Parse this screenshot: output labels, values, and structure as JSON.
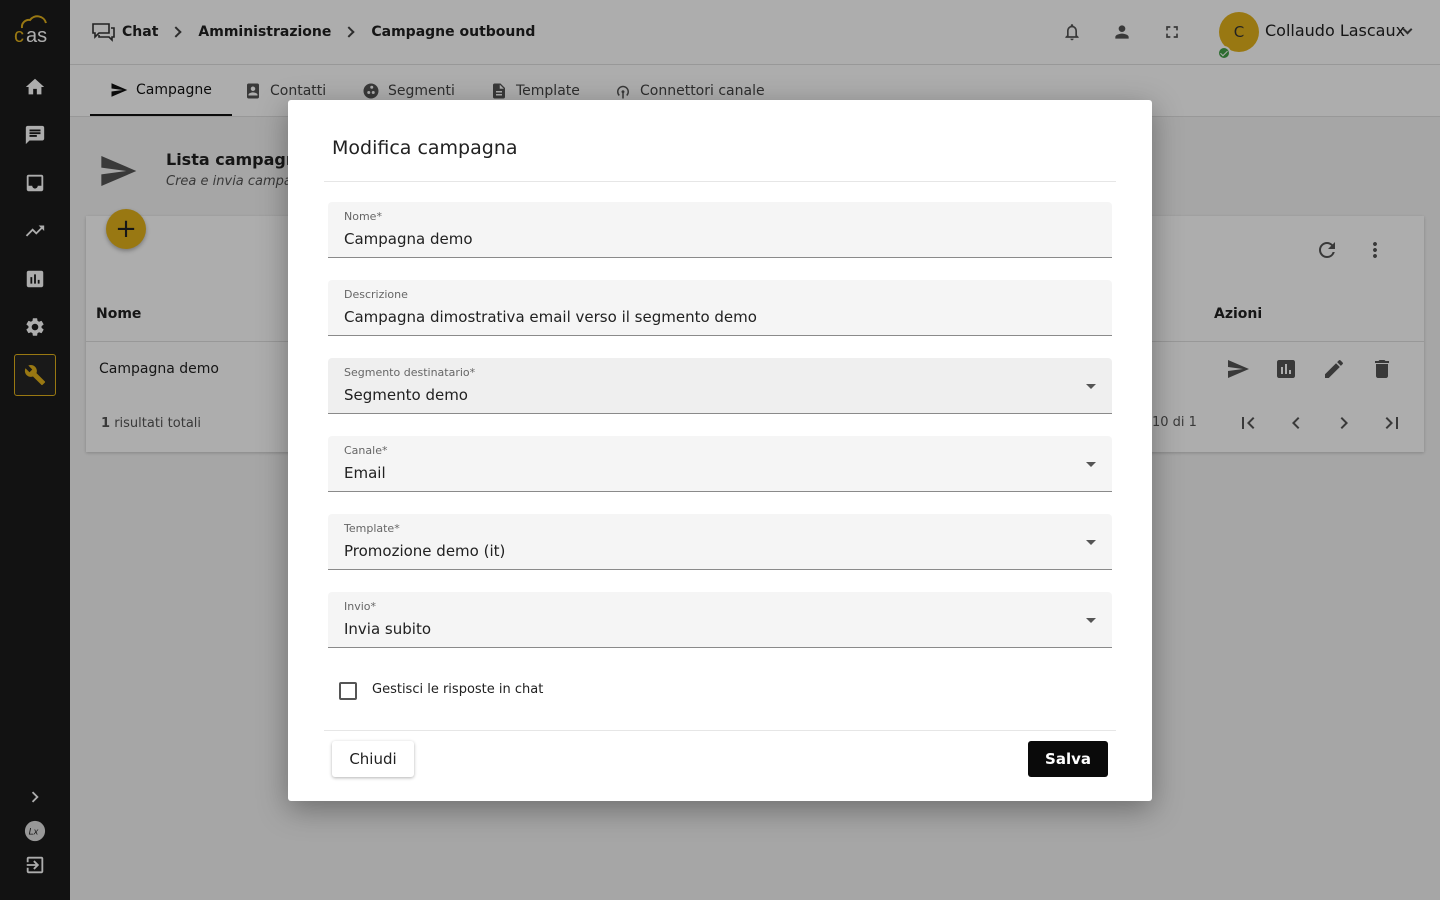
{
  "header": {
    "breadcrumbs": [
      "Chat",
      "Amministrazione",
      "Campagne outbound"
    ],
    "user": {
      "initial": "C",
      "name": "Collaudo Lascaux"
    }
  },
  "tabs": [
    {
      "label": "Campagne",
      "icon": "send-icon",
      "active": true
    },
    {
      "label": "Contatti",
      "icon": "contacts-icon"
    },
    {
      "label": "Segmenti",
      "icon": "segments-icon"
    },
    {
      "label": "Template",
      "icon": "document-icon"
    },
    {
      "label": "Connettori canale",
      "icon": "antenna-icon"
    }
  ],
  "page": {
    "title": "Lista campagne",
    "subtitle": "Crea e invia campa",
    "add_label": "+"
  },
  "table": {
    "columns": [
      "Nome",
      "Azioni"
    ],
    "rows": [
      {
        "name": "Campagna demo"
      }
    ],
    "total_count": "1",
    "total_label": "risultati totali",
    "range_label": "10 di 1"
  },
  "modal": {
    "title": "Modifica campagna",
    "fields": {
      "nome": {
        "label": "Nome*",
        "value": "Campagna demo"
      },
      "descrizione": {
        "label": "Descrizione",
        "value": "Campagna dimostrativa email verso il segmento demo"
      },
      "segmento": {
        "label": "Segmento destinatario*",
        "value": "Segmento demo"
      },
      "canale": {
        "label": "Canale*",
        "value": "Email"
      },
      "template": {
        "label": "Template*",
        "value": "Promozione demo (it)"
      },
      "invio": {
        "label": "Invio*",
        "value": "Invia subito"
      }
    },
    "checkbox_label": "Gestisci le risposte in chat",
    "checkbox_checked": false,
    "close_label": "Chiudi",
    "save_label": "Salva"
  },
  "colors": {
    "accent": "#e2b21b",
    "sidebar": "#1b1b1b",
    "online": "#43a047"
  }
}
